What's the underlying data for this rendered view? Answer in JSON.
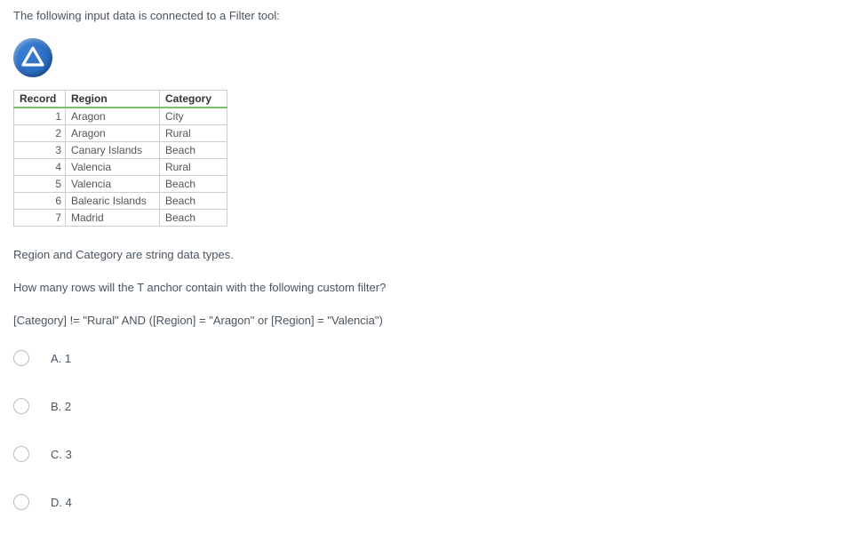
{
  "intro": "The following input data is connected to a Filter tool:",
  "icon_name": "filter-tool-icon",
  "table": {
    "headers": {
      "record": "Record",
      "region": "Region",
      "category": "Category"
    },
    "rows": [
      {
        "record": "1",
        "region": "Aragon",
        "category": "City"
      },
      {
        "record": "2",
        "region": "Aragon",
        "category": "Rural"
      },
      {
        "record": "3",
        "region": "Canary Islands",
        "category": "Beach"
      },
      {
        "record": "4",
        "region": "Valencia",
        "category": "Rural"
      },
      {
        "record": "5",
        "region": "Valencia",
        "category": "Beach"
      },
      {
        "record": "6",
        "region": "Balearic Islands",
        "category": "Beach"
      },
      {
        "record": "7",
        "region": "Madrid",
        "category": "Beach"
      }
    ]
  },
  "note": "Region and Category are string data types.",
  "question": "How many rows will the T anchor contain with the following custom filter?",
  "filter_expr": "[Category] != \"Rural\" AND ([Region] = \"Aragon\" or [Region] = \"Valencia\")",
  "options": [
    {
      "key": "a",
      "label": "A. 1"
    },
    {
      "key": "b",
      "label": "B. 2"
    },
    {
      "key": "c",
      "label": "C. 3"
    },
    {
      "key": "d",
      "label": "D. 4"
    }
  ]
}
